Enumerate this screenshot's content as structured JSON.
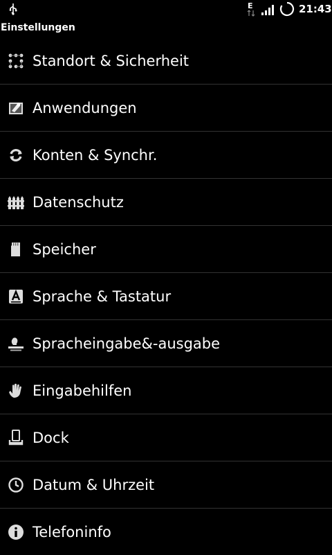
{
  "status_bar": {
    "time": "21:43",
    "network_type": "E",
    "icons": [
      "usb-icon",
      "edge-data-icon",
      "signal-icon",
      "sync-spinner-icon"
    ]
  },
  "header": {
    "title": "Einstellungen"
  },
  "settings": {
    "items": [
      {
        "label": "Standort & Sicherheit",
        "icon": "location-security-icon"
      },
      {
        "label": "Anwendungen",
        "icon": "applications-icon"
      },
      {
        "label": "Konten & Synchr.",
        "icon": "sync-icon"
      },
      {
        "label": "Datenschutz",
        "icon": "privacy-fence-icon"
      },
      {
        "label": "Speicher",
        "icon": "sd-card-icon"
      },
      {
        "label": "Sprache & Tastatur",
        "icon": "language-keyboard-icon"
      },
      {
        "label": "Spracheingabe&-ausgabe",
        "icon": "voice-input-output-icon"
      },
      {
        "label": "Eingabehilfen",
        "icon": "accessibility-hand-icon"
      },
      {
        "label": "Dock",
        "icon": "dock-icon"
      },
      {
        "label": "Datum & Uhrzeit",
        "icon": "clock-icon"
      },
      {
        "label": "Telefoninfo",
        "icon": "info-icon"
      }
    ]
  },
  "colors": {
    "background": "#000000",
    "text": "#ffffff",
    "divider": "#333333"
  }
}
